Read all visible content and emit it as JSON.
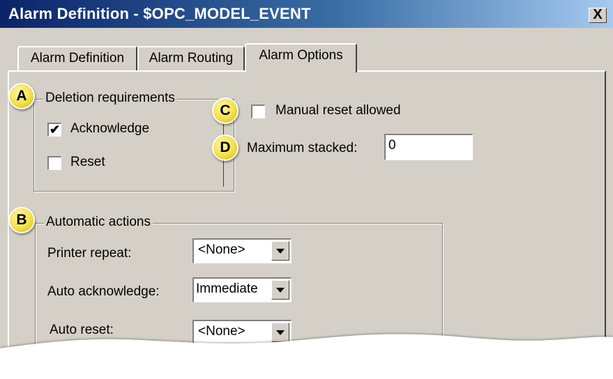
{
  "window": {
    "title": "Alarm Definition - $OPC_MODEL_EVENT",
    "close_label": "X"
  },
  "tabs": [
    {
      "label": "Alarm Definition"
    },
    {
      "label": "Alarm Routing"
    },
    {
      "label": "Alarm Options",
      "active": true
    }
  ],
  "deletion": {
    "legend": "Deletion requirements",
    "acknowledge": {
      "label": "Acknowledge",
      "checked": true,
      "mark": "✔"
    },
    "reset": {
      "label": "Reset",
      "checked": false
    }
  },
  "manual_reset": {
    "label": "Manual reset allowed",
    "checked": false
  },
  "max_stacked": {
    "label": "Maximum stacked:",
    "value": "0"
  },
  "automatic": {
    "legend": "Automatic actions",
    "printer_repeat": {
      "label": "Printer repeat:",
      "value": "<None>"
    },
    "auto_ack": {
      "label": "Auto acknowledge:",
      "value": "Immediate"
    },
    "auto_reset": {
      "label": "Auto reset:",
      "value": "<None>"
    }
  },
  "callouts": {
    "a": "A",
    "b": "B",
    "c": "C",
    "d": "D"
  }
}
